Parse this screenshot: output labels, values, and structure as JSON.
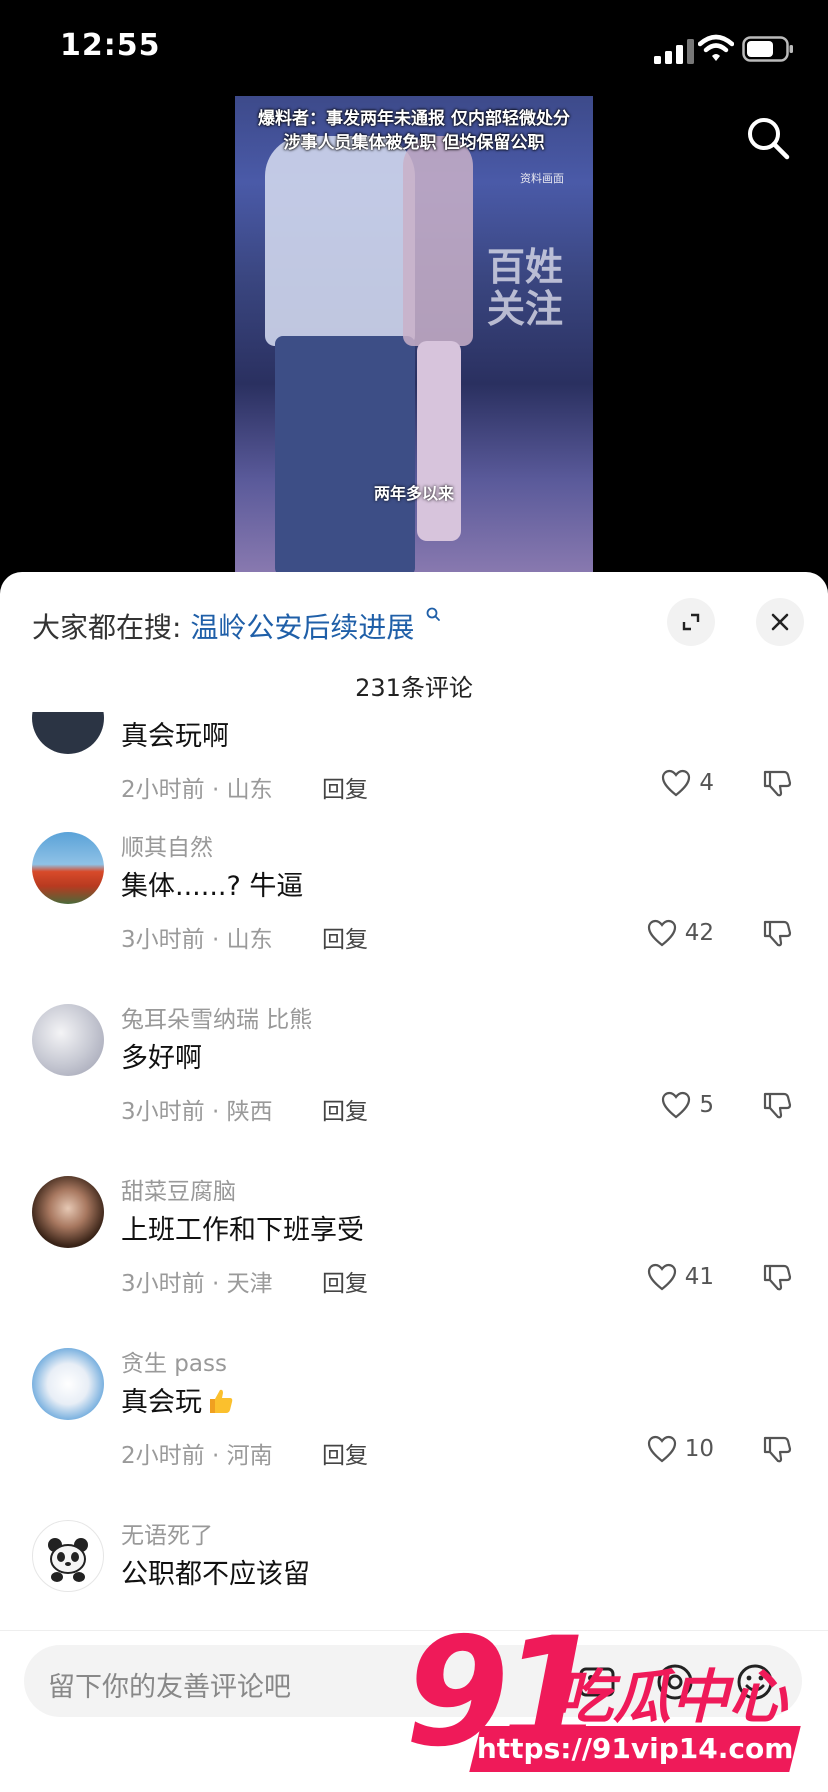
{
  "status_bar": {
    "time": "12:55"
  },
  "video": {
    "caption_line1": "爆料者：事发两年未通报 仅内部轻微处分",
    "caption_line2": "涉事人员集体被免职 但均保留公职",
    "source_note": "资料画面",
    "watermark_line1": "百姓",
    "watermark_line2": "关注",
    "subtitle": "两年多以来"
  },
  "hot_search": {
    "prefix": "大家都在搜:",
    "keyword": "温岭公安后续进展"
  },
  "comment_count": "231条评论",
  "comments": [
    {
      "user": "",
      "text": "真会玩啊",
      "time": "2小时前",
      "location": "山东",
      "reply": "回复",
      "likes": "4"
    },
    {
      "user": "顺其自然",
      "text": "集体......? 牛逼",
      "time": "3小时前",
      "location": "山东",
      "reply": "回复",
      "likes": "42"
    },
    {
      "user": "兔耳朵雪纳瑞 比熊",
      "text": "多好啊",
      "time": "3小时前",
      "location": "陕西",
      "reply": "回复",
      "likes": "5"
    },
    {
      "user": "甜菜豆腐脑",
      "text": "上班工作和下班享受",
      "time": "3小时前",
      "location": "天津",
      "reply": "回复",
      "likes": "41"
    },
    {
      "user": "贪生 pass",
      "text": "真会玩",
      "time": "2小时前",
      "location": "河南",
      "reply": "回复",
      "likes": "10"
    },
    {
      "user": "无语死了",
      "text": "公职都不应该留",
      "time": "",
      "location": "",
      "reply": "",
      "likes": ""
    }
  ],
  "meta_separator": " · ",
  "input": {
    "placeholder": "留下你的友善评论吧"
  },
  "watermark": {
    "logo_number": "91",
    "logo_text": "吃瓜中心",
    "url": "https://91vip14.com"
  },
  "colors": {
    "keyword": "#1f5fa8",
    "brand_pink": "#ef1a59"
  }
}
